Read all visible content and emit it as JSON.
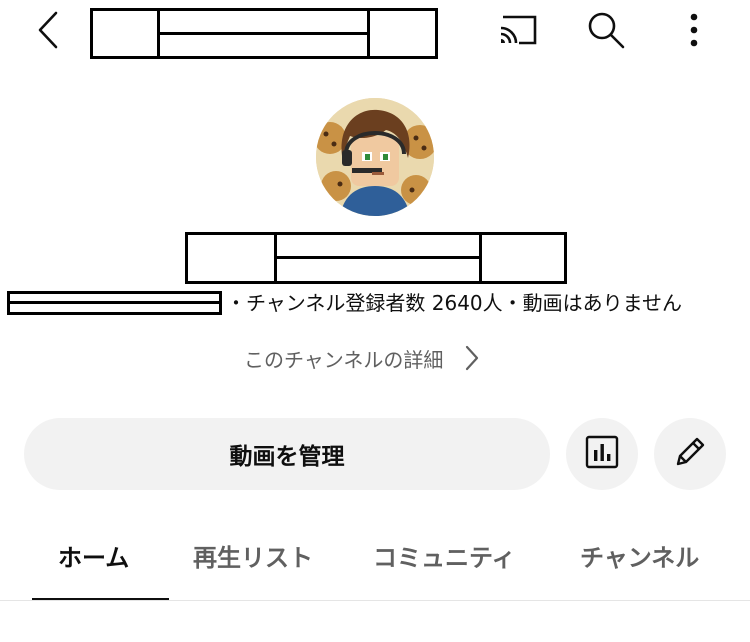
{
  "header": {
    "back_icon": "chevron-left-icon",
    "title_redacted": true,
    "cast_icon": "cast-icon",
    "search_icon": "search-icon",
    "more_icon": "more-vertical-icon"
  },
  "channel": {
    "name_redacted": true,
    "handle_redacted": true,
    "stats": "・チャンネル登録者数 2640人・動画はありません",
    "about_label": "このチャンネルの詳細"
  },
  "actions": {
    "manage_videos_label": "動画を管理",
    "analytics_icon": "analytics-icon",
    "edit_icon": "pencil-icon"
  },
  "tabs": [
    {
      "label": "ホーム",
      "active": true
    },
    {
      "label": "再生リスト",
      "active": false
    },
    {
      "label": "コミュニティ",
      "active": false
    },
    {
      "label": "チャンネル",
      "active": false
    }
  ],
  "colors": {
    "text_primary": "#0f0f0f",
    "text_secondary": "#606060",
    "button_bg": "#f2f2f2",
    "divider": "#e5e5e5"
  }
}
